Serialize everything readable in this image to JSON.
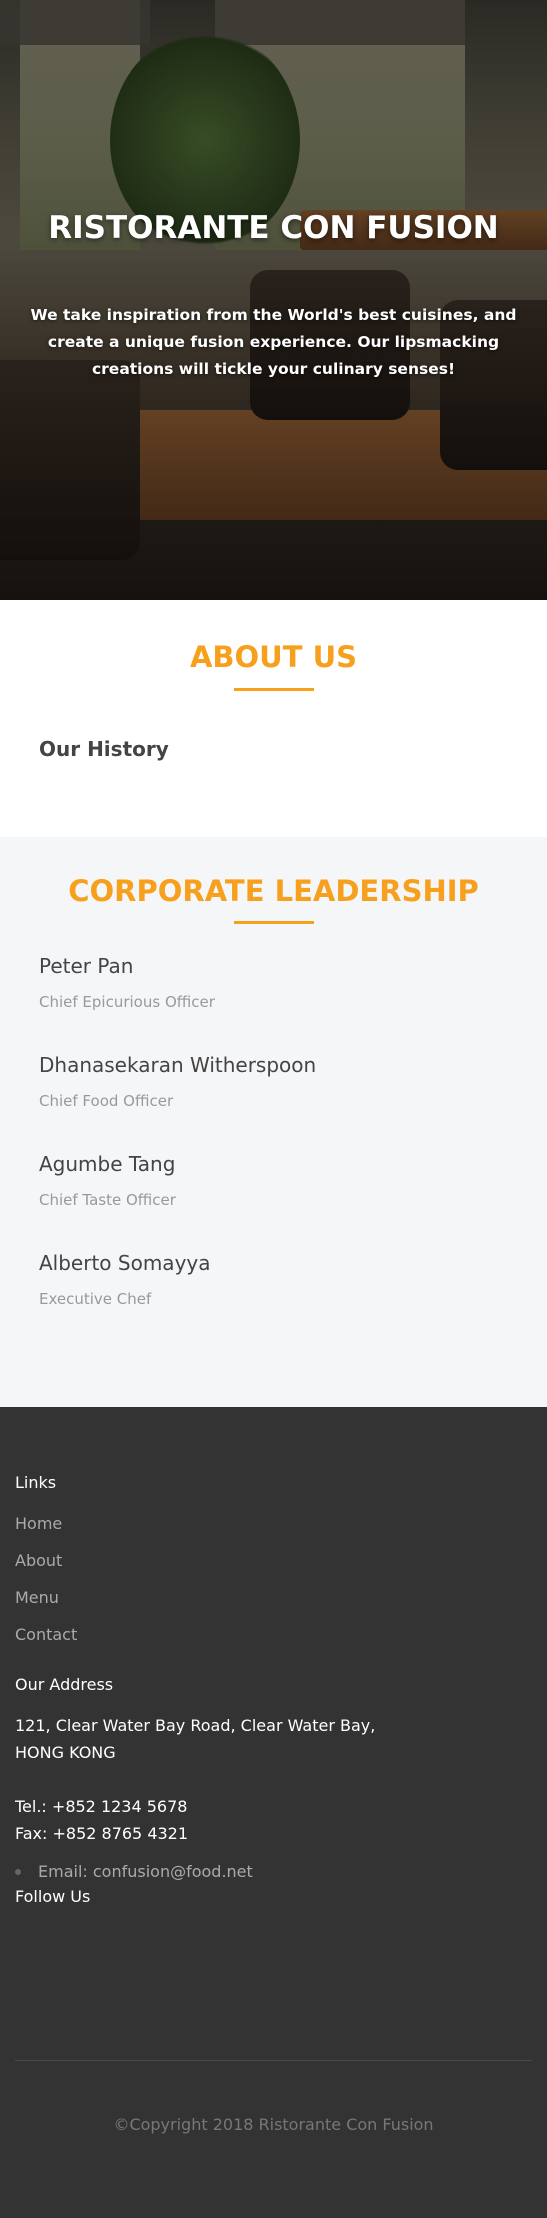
{
  "hero": {
    "title": "RISTORANTE CON FUSION",
    "text": "We take inspiration from the World's best cuisines, and create a unique fusion experience. Our lipsmacking creations will tickle your culinary senses!"
  },
  "about": {
    "title": "ABOUT US",
    "history_label": "Our History"
  },
  "leadership": {
    "title": "CORPORATE LEADERSHIP",
    "leaders": [
      {
        "name": "Peter Pan",
        "role": "Chief Epicurious Officer"
      },
      {
        "name": "Dhanasekaran Witherspoon",
        "role": "Chief Food Officer"
      },
      {
        "name": "Agumbe Tang",
        "role": "Chief Taste Officer"
      },
      {
        "name": "Alberto Somayya",
        "role": "Executive Chef"
      }
    ]
  },
  "footer": {
    "links_title": "Links",
    "links": [
      "Home",
      "About",
      "Menu",
      "Contact"
    ],
    "address_title": "Our Address",
    "address_line1": "121, Clear Water Bay Road, Clear Water Bay,",
    "address_line2": "HONG KONG",
    "tel": "Tel.: +852 1234 5678",
    "fax": "Fax: +852 8765 4321",
    "email": "Email: confusion@food.net",
    "follow_title": "Follow Us",
    "copyright": "©Copyright 2018 Ristorante Con Fusion"
  },
  "colors": {
    "accent": "#f7a01e",
    "footer_bg": "#333333",
    "leadership_bg": "#f5f6f8"
  }
}
